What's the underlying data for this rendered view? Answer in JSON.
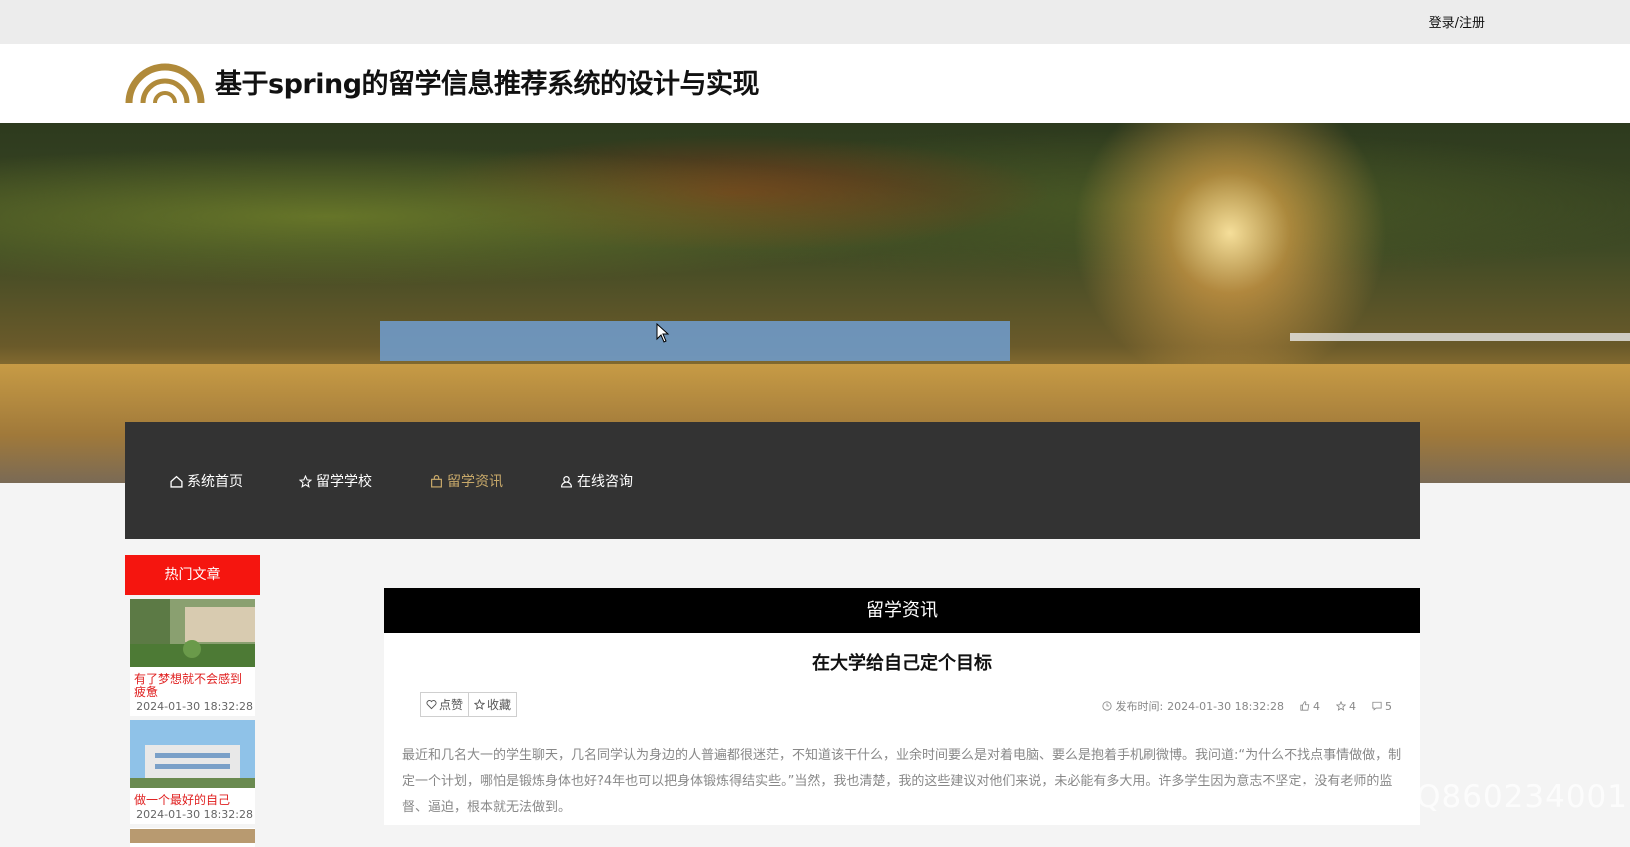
{
  "topbar": {
    "login_label": "登录/注册"
  },
  "header": {
    "site_title": "基于spring的留学信息推荐系统的设计与实现"
  },
  "nav": {
    "items": [
      {
        "label": "系统首页",
        "icon": "home-icon"
      },
      {
        "label": "留学学校",
        "icon": "star-icon"
      },
      {
        "label": "留学资讯",
        "icon": "bag-icon",
        "active": true
      },
      {
        "label": "在线咨询",
        "icon": "user-icon"
      }
    ]
  },
  "sidebar": {
    "title": "热门文章",
    "articles": [
      {
        "title": "有了梦想就不会感到疲惫",
        "date": "2024-01-30 18:32:28"
      },
      {
        "title": "做一个最好的自己",
        "date": "2024-01-30 18:32:28"
      }
    ]
  },
  "main": {
    "section_title": "留学资讯",
    "article_title": "在大学给自己定个目标",
    "like_label": "点赞",
    "collect_label": "收藏",
    "publish_time_label": "发布时间:",
    "publish_time": "2024-01-30 18:32:28",
    "like_count": "4",
    "collect_count": "4",
    "comment_count": "5",
    "body": "最近和几名大一的学生聊天，几名同学认为身边的人普遍都很迷茫，不知道该干什么，业余时间要么是对着电脑、要么是抱着手机刷微博。我问道:“为什么不找点事情做做，制定一个计划，哪怕是锻炼身体也好?4年也可以把身体锻炼得结实些。”当然，我也清楚，我的这些建议对他们来说，未必能有多大用。许多学生因为意志不坚定，没有老师的监督、逼迫，根本就无法做到。"
  },
  "watermark": "CSDN @QQ860234001",
  "colors": {
    "nav_bg": "#333333",
    "accent": "#c8a96a",
    "hot_red": "#f5150f",
    "title_bar": "#000000"
  }
}
